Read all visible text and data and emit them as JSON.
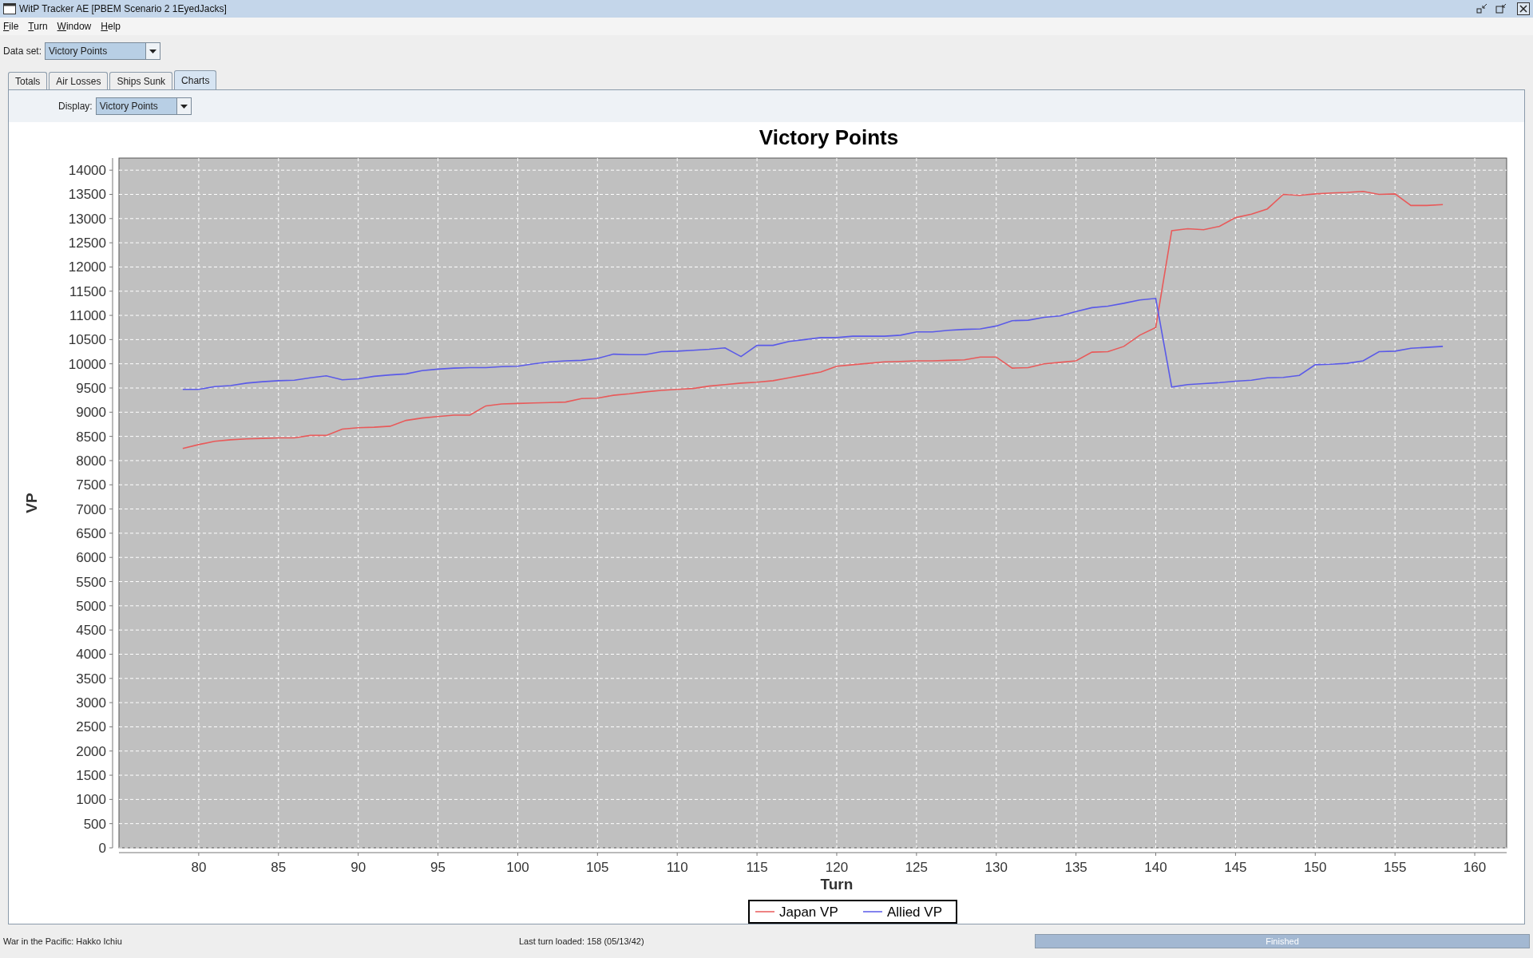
{
  "window": {
    "title": "WitP Tracker AE [PBEM Scenario 2 1EyedJacks]"
  },
  "menu": [
    "File",
    "Turn",
    "Window",
    "Help"
  ],
  "dataset": {
    "label": "Data set:",
    "value": "Victory Points"
  },
  "tabs": [
    {
      "label": "Totals",
      "selected": false
    },
    {
      "label": "Air Losses",
      "selected": false
    },
    {
      "label": "Ships Sunk",
      "selected": false
    },
    {
      "label": "Charts",
      "selected": true
    }
  ],
  "display": {
    "label": "Display:",
    "value": "Victory Points"
  },
  "chart": {
    "chart_data": {
      "type": "line",
      "title": "Victory Points",
      "xlabel": "Turn",
      "ylabel": "VP",
      "x": [
        79,
        80,
        81,
        82,
        83,
        84,
        85,
        86,
        87,
        88,
        89,
        90,
        91,
        92,
        93,
        94,
        95,
        96,
        97,
        98,
        99,
        100,
        101,
        102,
        103,
        104,
        105,
        106,
        107,
        108,
        109,
        110,
        111,
        112,
        113,
        114,
        115,
        116,
        117,
        118,
        119,
        120,
        121,
        122,
        123,
        124,
        125,
        126,
        127,
        128,
        129,
        130,
        131,
        132,
        133,
        134,
        135,
        136,
        137,
        138,
        139,
        140,
        141,
        142,
        143,
        144,
        145,
        146,
        147,
        148,
        149,
        150,
        151,
        152,
        153,
        154,
        155,
        156,
        157,
        158
      ],
      "series": [
        {
          "name": "Japan VP",
          "color": "#e85a5a",
          "values": [
            8250,
            8330,
            8400,
            8430,
            8450,
            8460,
            8470,
            8470,
            8520,
            8520,
            8650,
            8680,
            8690,
            8710,
            8830,
            8880,
            8910,
            8940,
            8940,
            9130,
            9170,
            9180,
            9190,
            9200,
            9210,
            9280,
            9290,
            9350,
            9380,
            9420,
            9450,
            9470,
            9490,
            9540,
            9570,
            9600,
            9620,
            9650,
            9710,
            9770,
            9830,
            9950,
            9980,
            10010,
            10040,
            10050,
            10060,
            10060,
            10070,
            10080,
            10140,
            10140,
            9910,
            9920,
            10000,
            10030,
            10060,
            10240,
            10250,
            10360,
            10590,
            10750,
            12750,
            12790,
            12770,
            12840,
            13020,
            13090,
            13200,
            13500,
            13480,
            13510,
            13530,
            13540,
            13560,
            13500,
            13510,
            13270,
            13270,
            13290
          ]
        },
        {
          "name": "Allied VP",
          "color": "#5a5ae8",
          "values": [
            9470,
            9470,
            9530,
            9550,
            9600,
            9630,
            9650,
            9660,
            9710,
            9750,
            9670,
            9690,
            9740,
            9770,
            9790,
            9860,
            9890,
            9910,
            9920,
            9920,
            9940,
            9950,
            10000,
            10040,
            10060,
            10070,
            10110,
            10200,
            10190,
            10190,
            10250,
            10260,
            10280,
            10300,
            10330,
            10150,
            10380,
            10380,
            10460,
            10500,
            10540,
            10540,
            10570,
            10570,
            10570,
            10590,
            10660,
            10660,
            10690,
            10710,
            10720,
            10780,
            10890,
            10900,
            10960,
            10990,
            11080,
            11160,
            11190,
            11250,
            11320,
            11350,
            9520,
            9570,
            9590,
            9610,
            9640,
            9660,
            9710,
            9720,
            9760,
            9980,
            9990,
            10010,
            10060,
            10250,
            10260,
            10320,
            10340,
            10360
          ]
        }
      ],
      "grid": true,
      "legend": "bottom",
      "xlim": [
        75,
        162
      ],
      "ylim": [
        0,
        14250
      ],
      "xticks": [
        80,
        85,
        90,
        95,
        100,
        105,
        110,
        115,
        120,
        125,
        130,
        135,
        140,
        145,
        150,
        155,
        160
      ],
      "yticks": [
        0,
        500,
        1000,
        1500,
        2000,
        2500,
        3000,
        3500,
        4000,
        4500,
        5000,
        5500,
        6000,
        6500,
        7000,
        7500,
        8000,
        8500,
        9000,
        9500,
        10000,
        10500,
        11000,
        11500,
        12000,
        12500,
        13000,
        13500,
        14000
      ]
    }
  },
  "status_bar": {
    "left": "War in the Pacific: Hakko Ichiu",
    "center": "Last turn loaded: 158 (05/13/42)",
    "progress": {
      "label": "Finished",
      "level": 1
    }
  }
}
